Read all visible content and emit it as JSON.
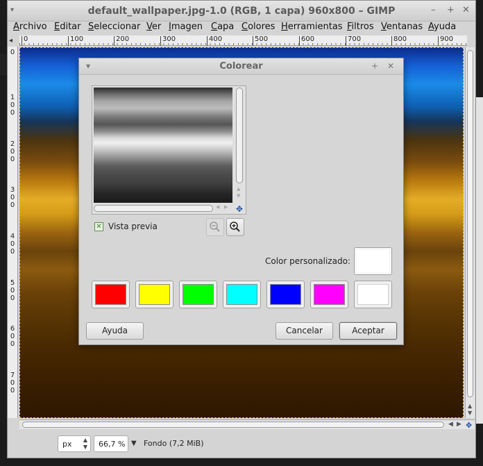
{
  "window": {
    "title": "default_wallpaper.jpg-1.0 (RGB, 1 capa) 960x800 – GIMP",
    "menus": [
      "Archivo",
      "Editar",
      "Seleccionar",
      "Ver",
      "Imagen",
      "Capa",
      "Colores",
      "Herramientas",
      "Filtros",
      "Ventanas",
      "Ayuda"
    ],
    "ruler_top": [
      "0",
      "100",
      "200",
      "300",
      "400",
      "500",
      "600",
      "700",
      "800",
      "900"
    ],
    "ruler_left": [
      "0",
      "1 0 0",
      "2 0 0",
      "3 0 0",
      "4 0 0",
      "5 0 0",
      "6 0 0",
      "7 0 0"
    ]
  },
  "status": {
    "unit": "px",
    "zoom": "66,7 %",
    "layer_info": "Fondo (7,2 MiB)"
  },
  "dialog": {
    "title": "Colorear",
    "preview_label": "Vista previa",
    "preview_checked": true,
    "custom_color_label": "Color personalizado:",
    "custom_color": "#ffffff",
    "swatches": [
      "#ff0000",
      "#ffff00",
      "#00ff00",
      "#00ffff",
      "#0000ff",
      "#ff00ff",
      "#ffffff"
    ],
    "buttons": {
      "help": "Ayuda",
      "cancel": "Cancelar",
      "accept": "Aceptar"
    }
  }
}
